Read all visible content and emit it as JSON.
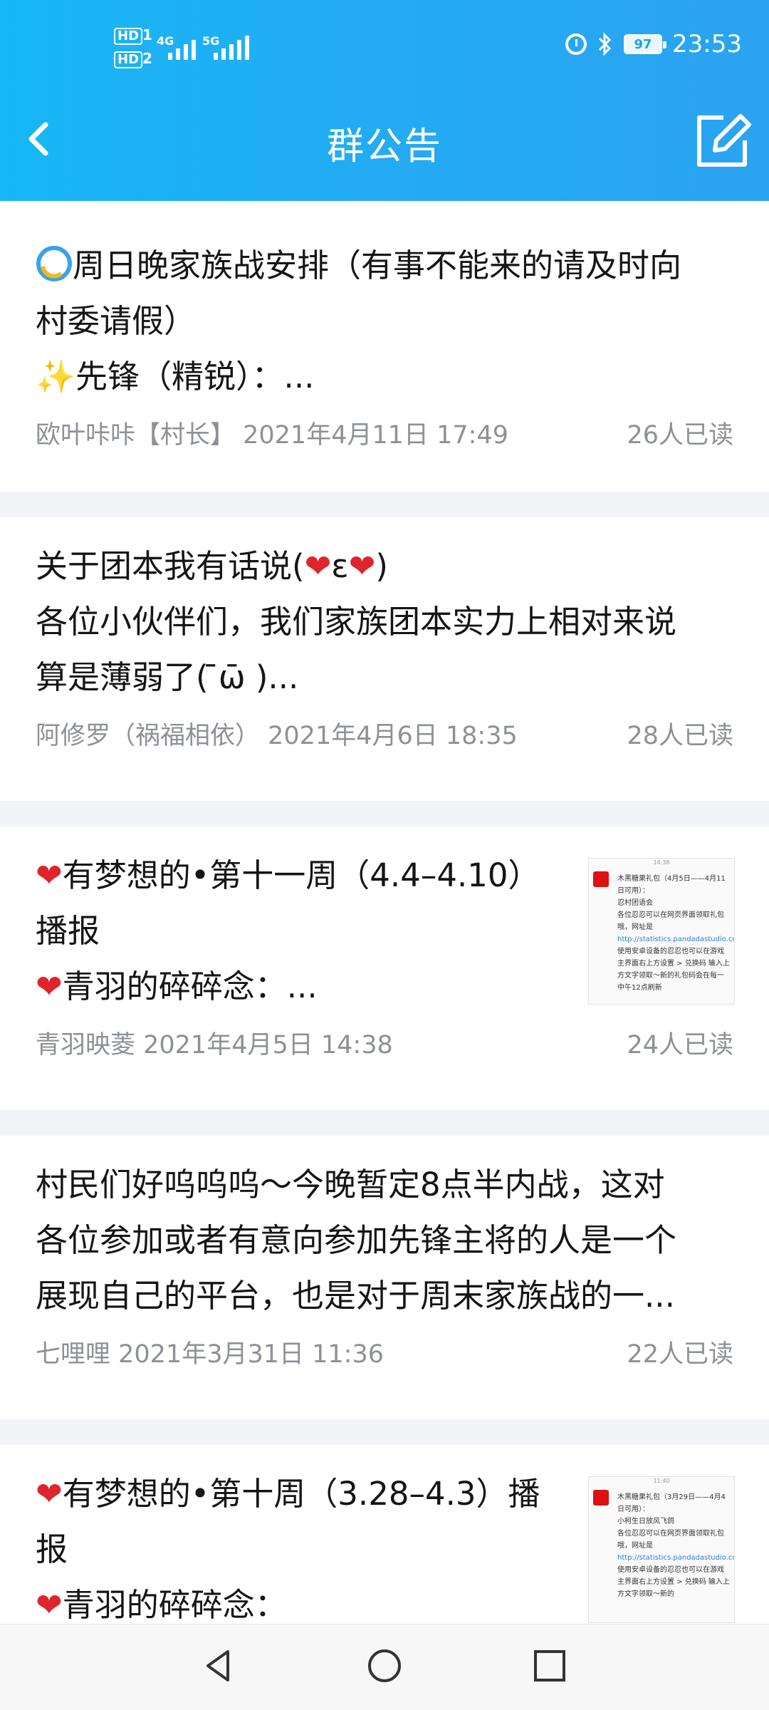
{
  "status_bar": {
    "sim1_label": "HD",
    "sim1_num": "1",
    "sim2_label": "HD",
    "sim2_num": "2",
    "net1": "4G",
    "net2": "5G",
    "battery": "97",
    "time": "23:53"
  },
  "header": {
    "title": "群公告",
    "back_icon": "chevron-left-icon",
    "edit_icon": "edit-icon",
    "color": "#1fb0f4"
  },
  "announcements": [
    {
      "line1": "周日晚家族战安排（有事不能来的请及时向",
      "line2": "村委请假）",
      "line3": "先锋（精锐）：...",
      "author": "欧叶咔咔【村长】 2021年4月11日 17:49",
      "reads": "26人已读"
    },
    {
      "line1": "关于团本我有话说(",
      "line1_mid": "ε",
      "line1_end": ")",
      "line2": "各位小伙伴们，我们家族团本实力上相对来说",
      "line3": "算是薄弱了( ̄ω̄ )...",
      "author": "阿修罗（祸福相依） 2021年4月6日 18:35",
      "reads": "28人已读"
    },
    {
      "line1": "有梦想的•第十一周（4.4–4.10）",
      "line2": "播报",
      "line3": "青羽的碎碎念：...",
      "author": "青羽映菱 2021年4月5日 14:38",
      "reads": "24人已读",
      "thumb": {
        "time": "14:38",
        "title": "木黑糖果礼包（4月5日——4月11日可用）：",
        "subtitle": "忍村团语会",
        "body": "各位忍忍可以在网页界面领取礼包哦，网址是",
        "link": "http://statistics.pandadastudio.com/player/giftCodeView",
        "body2": "，使用安卓设备的忍忍也可以在游戏主界面右上方设置 > 兑换码 输入上方文字领取～新的礼包码会在每一中午12点刷新"
      }
    },
    {
      "line1": "村民们好呜呜呜～今晚暂定8点半内战，这对",
      "line2": "各位参加或者有意向参加先锋主将的人是一个",
      "line3": "展现自己的平台，也是对于周末家族战的一...",
      "author": "七哩哩 2021年3月31日 11:36",
      "reads": "22人已读"
    },
    {
      "line1": "有梦想的•第十周（3.28–4.3）播",
      "line2": "报",
      "line3": "青羽的碎碎念：",
      "thumb": {
        "time": "11:40",
        "title": "木黑糖果礼包（3月29日——4月4日可用）：",
        "subtitle": "小柯生日放风飞鸽",
        "body": "各位忍忍可以在网页界面领取礼包哦，网址是",
        "link": "http://statistics.pandadastudio.com/player/giftCodeView",
        "body2": "，使用安卓设备的忍忍也可以在游戏主界面右上方设置 > 兑换码 输入上方文字领取～新的"
      }
    }
  ],
  "nav": {
    "back_icon": "triangle-back-icon",
    "home_icon": "circle-home-icon",
    "recents_icon": "square-recents-icon"
  }
}
